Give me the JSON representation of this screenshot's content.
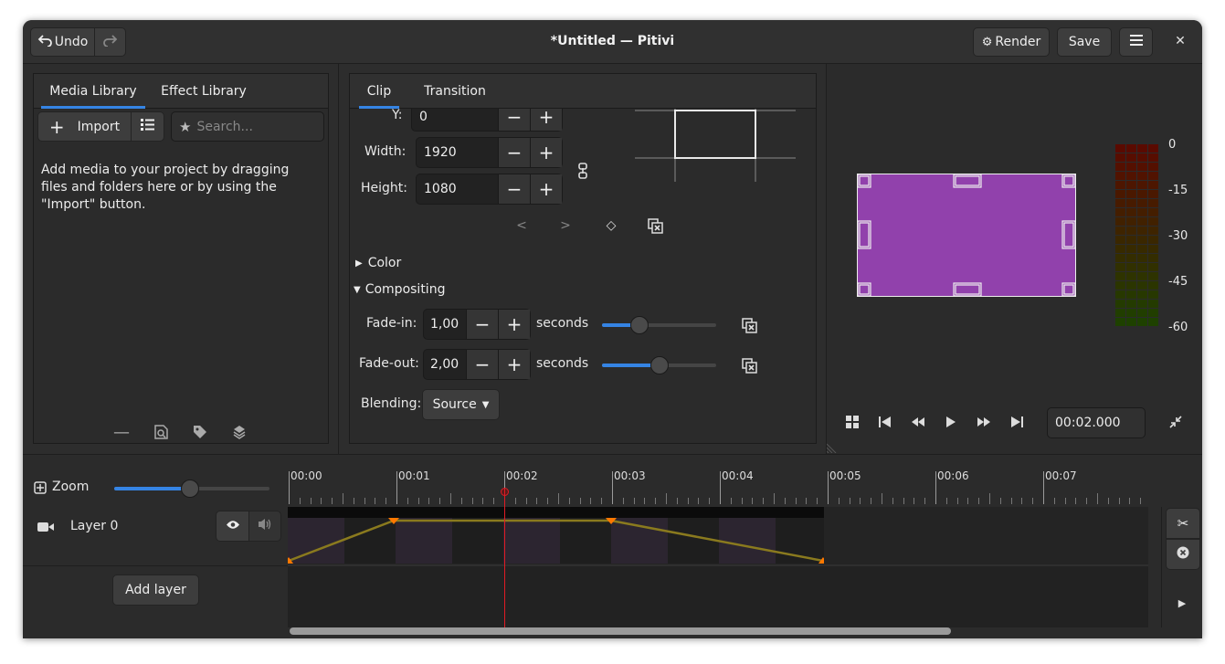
{
  "window": {
    "title": "*Untitled — Pitivi",
    "undo_label": "Undo",
    "render_label": "Render",
    "save_label": "Save"
  },
  "library": {
    "tabs": [
      {
        "label": "Media Library",
        "active": true
      },
      {
        "label": "Effect Library",
        "active": false
      }
    ],
    "import_label": "Import",
    "search_placeholder": "Search...",
    "hint": "Add media to your project by dragging files and folders here or by using the \"Import\" button."
  },
  "clip_props": {
    "tabs": [
      {
        "label": "Clip",
        "active": true
      },
      {
        "label": "Transition",
        "active": false
      }
    ],
    "y_label": "Y:",
    "y_value": "0",
    "width_label": "Width:",
    "width_value": "1920",
    "height_label": "Height:",
    "height_value": "1080",
    "keyframe_prev": "<",
    "keyframe_next": ">",
    "color_section": "Color",
    "compositing_section": "Compositing",
    "fadein_label": "Fade-in:",
    "fadein_value": "1,00",
    "fadein_unit": "seconds",
    "fadein_slider": 0.33,
    "fadeout_label": "Fade-out:",
    "fadeout_value": "2,00",
    "fadeout_unit": "seconds",
    "fadeout_slider": 0.5,
    "blending_label": "Blending:",
    "blending_value": "Source"
  },
  "viewer": {
    "preview_color": "#9141ac",
    "meter_labels": [
      "0",
      "-15",
      "-30",
      "-45",
      "-60"
    ],
    "timecode": "00:02.000"
  },
  "timeline": {
    "zoom_label": "Zoom",
    "ruler_labels": [
      "00:00",
      "00:01",
      "00:02",
      "00:03",
      "00:04",
      "00:05",
      "00:06",
      "00:07"
    ],
    "layer_name": "Layer 0",
    "add_layer_label": "Add layer",
    "playhead_seconds": 2.0,
    "clip_end_seconds": 5.0
  },
  "colors": {
    "accent": "#3584e4",
    "playhead": "#e01b24",
    "keyframe": "#ff7800",
    "keyframe_line": "#8a7a1e"
  }
}
